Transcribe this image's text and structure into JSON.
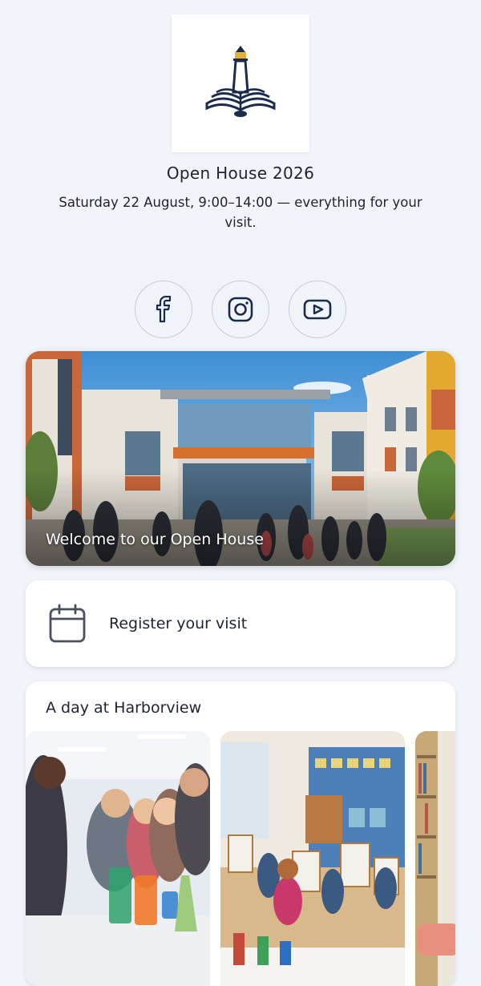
{
  "header": {
    "logo_icon": "lighthouse-book-logo",
    "title": "Open House 2026",
    "subtitle": "Saturday 22 August, 9:00–14:00 — everything for your visit."
  },
  "socials": [
    {
      "name": "facebook",
      "icon": "facebook-icon"
    },
    {
      "name": "instagram",
      "icon": "instagram-icon"
    },
    {
      "name": "youtube",
      "icon": "youtube-icon"
    }
  ],
  "hero": {
    "caption": "Welcome to our Open House"
  },
  "register": {
    "icon": "calendar-icon",
    "label": "Register your visit"
  },
  "gallery": {
    "title": "A day at Harborview",
    "photos": [
      "science-lab-photo",
      "art-class-photo",
      "library-photo"
    ]
  },
  "colors": {
    "background": "#f1f5fa",
    "navy": "#1b2b4b",
    "accent_orange": "#d8632a",
    "card": "#ffffff"
  }
}
